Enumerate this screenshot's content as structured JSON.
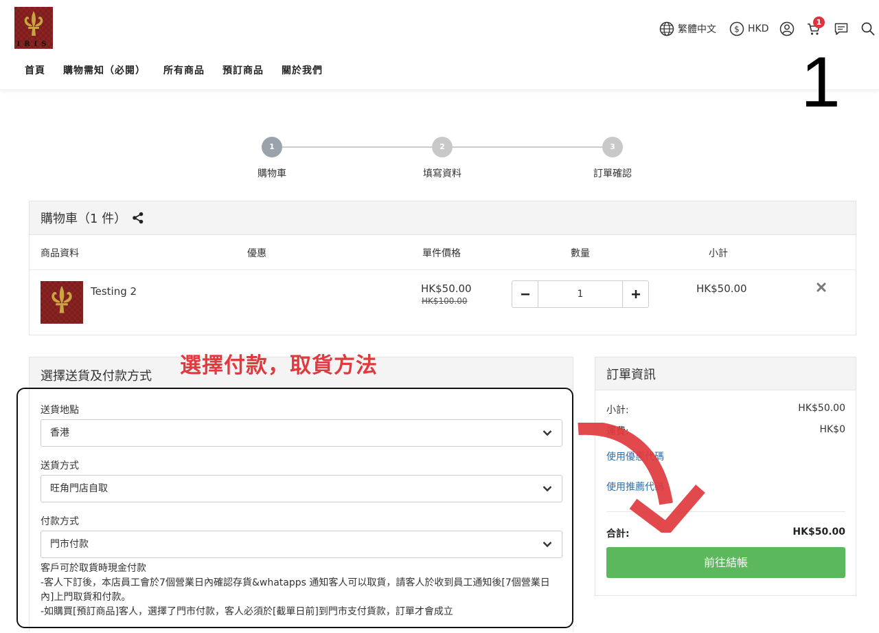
{
  "logo": {
    "text": "IRIS"
  },
  "header": {
    "language": "繁體中文",
    "currency": "HKD",
    "cart_count": "1"
  },
  "nav": [
    "首頁",
    "購物需知（必閱）",
    "所有商品",
    "預訂商品",
    "關於我們"
  ],
  "annotations": {
    "step_number": "1",
    "callout": "選擇付款，取貨方法"
  },
  "steps": [
    {
      "num": "1",
      "label": "購物車"
    },
    {
      "num": "2",
      "label": "填寫資料"
    },
    {
      "num": "3",
      "label": "訂單確認"
    }
  ],
  "cart": {
    "title": "購物車（1 件）",
    "columns": [
      "商品資料",
      "優惠",
      "單件價格",
      "數量",
      "小計"
    ],
    "item": {
      "name": "Testing 2",
      "price": "HK$50.00",
      "original_price": "HK$100.00",
      "quantity": "1",
      "subtotal": "HK$50.00"
    }
  },
  "delivery": {
    "title": "選擇送貨及付款方式",
    "location_label": "送貨地點",
    "location_value": "香港",
    "method_label": "送貨方式",
    "method_value": "旺角門店自取",
    "payment_label": "付款方式",
    "payment_value": "門市付款",
    "notes": [
      "客戶可於取貨時現金付款",
      "-客人下訂後，本店員工會於7個營業日內確認存貨&whatapps 通知客人可以取貨，請客人於收到員工通知後[7個營業日內]上門取貨和付款。",
      "-如購買[預訂商品]客人，選擇了門市付款，客人必須於[截單日前]到門市支付貨款，訂單才會成立"
    ]
  },
  "summary": {
    "title": "訂單資訊",
    "subtotal_label": "小計:",
    "subtotal_value": "HK$50.00",
    "shipping_label": "運費:",
    "shipping_value": "HK$0",
    "coupon_link": "使用優惠代碼",
    "referral_link": "使用推薦代碼",
    "total_label": "合計:",
    "total_value": "HK$50.00",
    "checkout_label": "前往結帳"
  },
  "colors": {
    "checkout_green": "#5cb85c",
    "link_blue": "#2a6fb0",
    "annotation_red": "#e0393e",
    "active_step": "#9aa3ab",
    "inactive_step": "#c8c8c8"
  }
}
